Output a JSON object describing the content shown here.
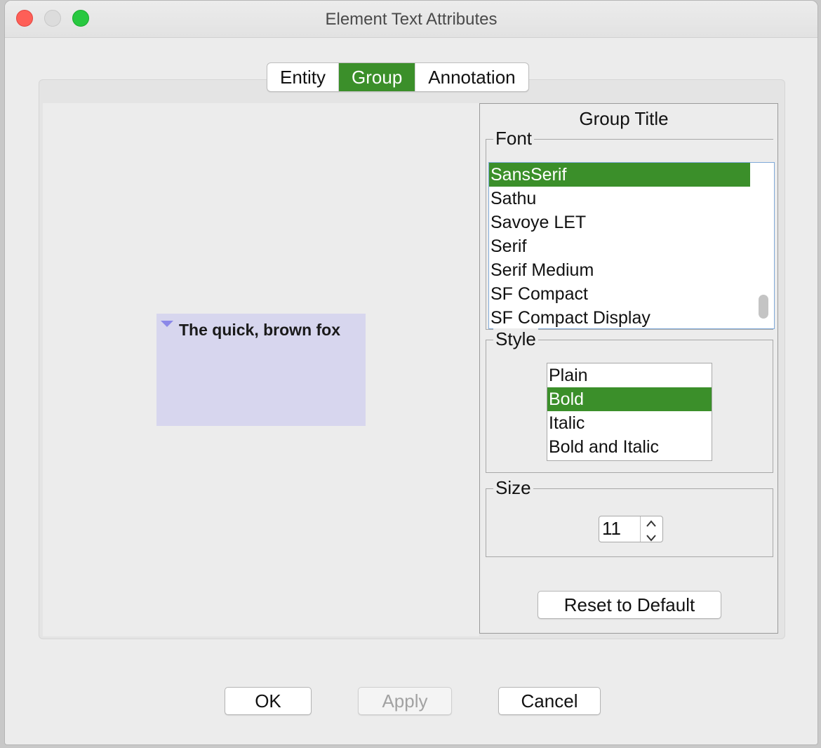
{
  "window": {
    "title": "Element Text Attributes",
    "controls": {
      "close_color": "#fe5f57",
      "minimize_color": "#dcdcdc",
      "maximize_color": "#28c840"
    }
  },
  "tabs": [
    {
      "label": "Entity",
      "active": false
    },
    {
      "label": "Group",
      "active": true
    },
    {
      "label": "Annotation",
      "active": false
    }
  ],
  "preview": {
    "sample_text": "The quick, brown fox",
    "box_color": "#d7d6ee",
    "arrow_color": "#8b88e8"
  },
  "panel": {
    "title": "Group Title",
    "font": {
      "legend": "Font",
      "items": [
        "SansSerif",
        "Sathu",
        "Savoye LET",
        "Serif",
        "Serif Medium",
        "SF Compact",
        "SF Compact Display"
      ],
      "selected": "SansSerif"
    },
    "style": {
      "legend": "Style",
      "items": [
        "Plain",
        "Bold",
        "Italic",
        "Bold and Italic"
      ],
      "selected": "Bold"
    },
    "size": {
      "legend": "Size",
      "value": "11"
    },
    "reset_label": "Reset to Default"
  },
  "buttons": {
    "ok": "OK",
    "apply": "Apply",
    "cancel": "Cancel"
  },
  "colors": {
    "accent": "#3b8f2a"
  }
}
